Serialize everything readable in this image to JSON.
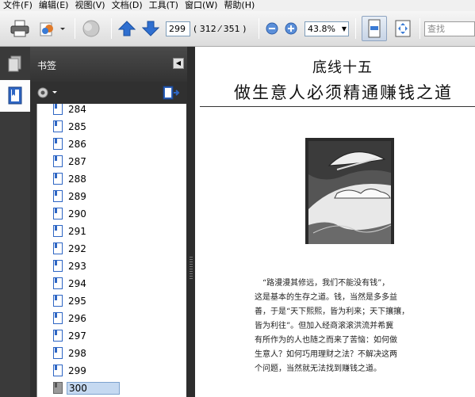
{
  "menu": {
    "items": [
      "文件(F)",
      "编辑(E)",
      "视图(V)",
      "文档(D)",
      "工具(T)",
      "窗口(W)",
      "帮助(H)"
    ]
  },
  "toolbar": {
    "current_page": "299",
    "page_count": "( 312 ⁄ 351 )",
    "zoom": "43.8%",
    "find_placeholder": "查找"
  },
  "panel": {
    "title": "书签",
    "bookmarks": [
      "284",
      "285",
      "286",
      "287",
      "288",
      "289",
      "290",
      "291",
      "292",
      "293",
      "294",
      "295",
      "296",
      "297",
      "298",
      "299",
      "300"
    ],
    "selected": "300"
  },
  "document": {
    "title_line1": "底线十五",
    "title_line2": "做生意人必须精通赚钱之道",
    "paragraph": [
      "“路漫漫其修远，我们不能没有钱”，",
      "这是基本的生存之道。钱，当然是多多益",
      "善，于是“天下熙熙，皆为利来；天下攘攘，",
      "皆为利往”。但加入经商滚滚洪流并希冀",
      "有所作为的人也随之而来了苦恼：如何做",
      "生意人？如何巧用理财之法？不解决这两",
      "个问题，当然就无法找到赚钱之道。"
    ]
  },
  "colors": {
    "dark_panel": "#2f2f2f",
    "selection": "#c5d9f1",
    "arrow_blue": "#2f6fd0"
  }
}
